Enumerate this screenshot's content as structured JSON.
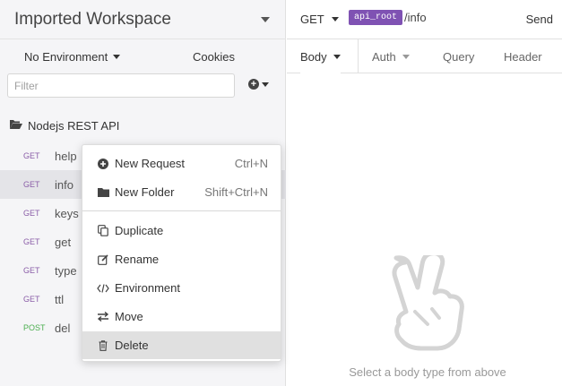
{
  "sidebar": {
    "workspace_title": "Imported Workspace",
    "environment_label": "No Environment",
    "cookies_label": "Cookies",
    "filter_placeholder": "Filter",
    "folder_name": "Nodejs REST API",
    "requests": [
      {
        "method": "GET",
        "name": "help"
      },
      {
        "method": "GET",
        "name": "info",
        "active": true
      },
      {
        "method": "GET",
        "name": "keys"
      },
      {
        "method": "GET",
        "name": "get"
      },
      {
        "method": "GET",
        "name": "type"
      },
      {
        "method": "GET",
        "name": "ttl"
      },
      {
        "method": "POST",
        "name": "del"
      }
    ]
  },
  "request_bar": {
    "method": "GET",
    "url_variable": "api_root",
    "url_path": "/info",
    "send_label": "Send"
  },
  "tabs": [
    {
      "label": "Body"
    },
    {
      "label": "Auth"
    },
    {
      "label": "Query"
    },
    {
      "label": "Header"
    }
  ],
  "body_panel": {
    "empty_text": "Select a body type from above"
  },
  "context_menu": {
    "items": [
      {
        "label": "New Request",
        "shortcut": "Ctrl+N",
        "icon": "plus-circle-icon"
      },
      {
        "label": "New Folder",
        "shortcut": "Shift+Ctrl+N",
        "icon": "folder-icon"
      },
      {
        "label": "Duplicate",
        "icon": "copy-icon"
      },
      {
        "label": "Rename",
        "icon": "edit-icon"
      },
      {
        "label": "Environment",
        "icon": "code-icon"
      },
      {
        "label": "Move",
        "icon": "exchange-icon"
      },
      {
        "label": "Delete",
        "icon": "trash-icon"
      }
    ]
  },
  "colors": {
    "get_method": "#8b5ea8",
    "post_method": "#4caf50",
    "variable_tag": "#7f52b3"
  }
}
